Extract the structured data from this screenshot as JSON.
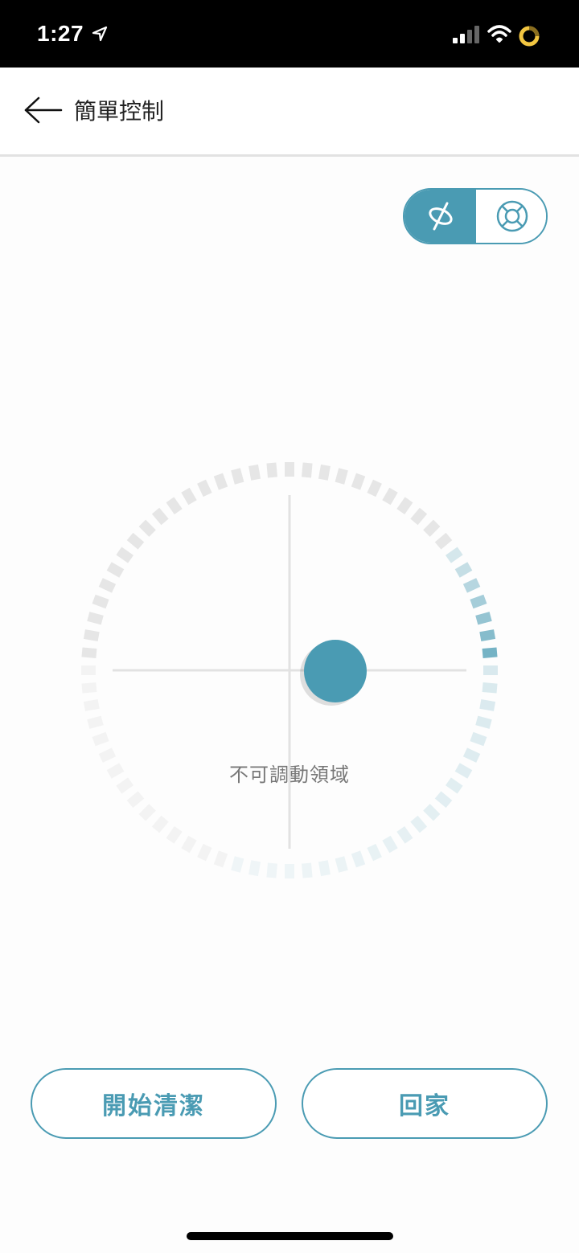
{
  "status_bar": {
    "time": "1:27",
    "icons": [
      "location-arrow-icon",
      "cellular-signal-icon",
      "wifi-icon",
      "activity-ring-icon"
    ]
  },
  "header": {
    "title": "簡單控制",
    "back_icon": "arrow-left-icon"
  },
  "mode_toggle": {
    "options": [
      {
        "icon": "fan-off-icon",
        "selected": true
      },
      {
        "icon": "lifebuoy-icon",
        "selected": false
      }
    ]
  },
  "joystick": {
    "zone_label": "不可調動領域"
  },
  "actions": {
    "start_clean": "開始清潔",
    "go_home": "回家"
  },
  "colors": {
    "accent": "#4a9bb3",
    "ring_inactive": "#e6e6e6",
    "ring_faint": "#f3f3f3",
    "ring_light_accent": "#dcecf0"
  }
}
